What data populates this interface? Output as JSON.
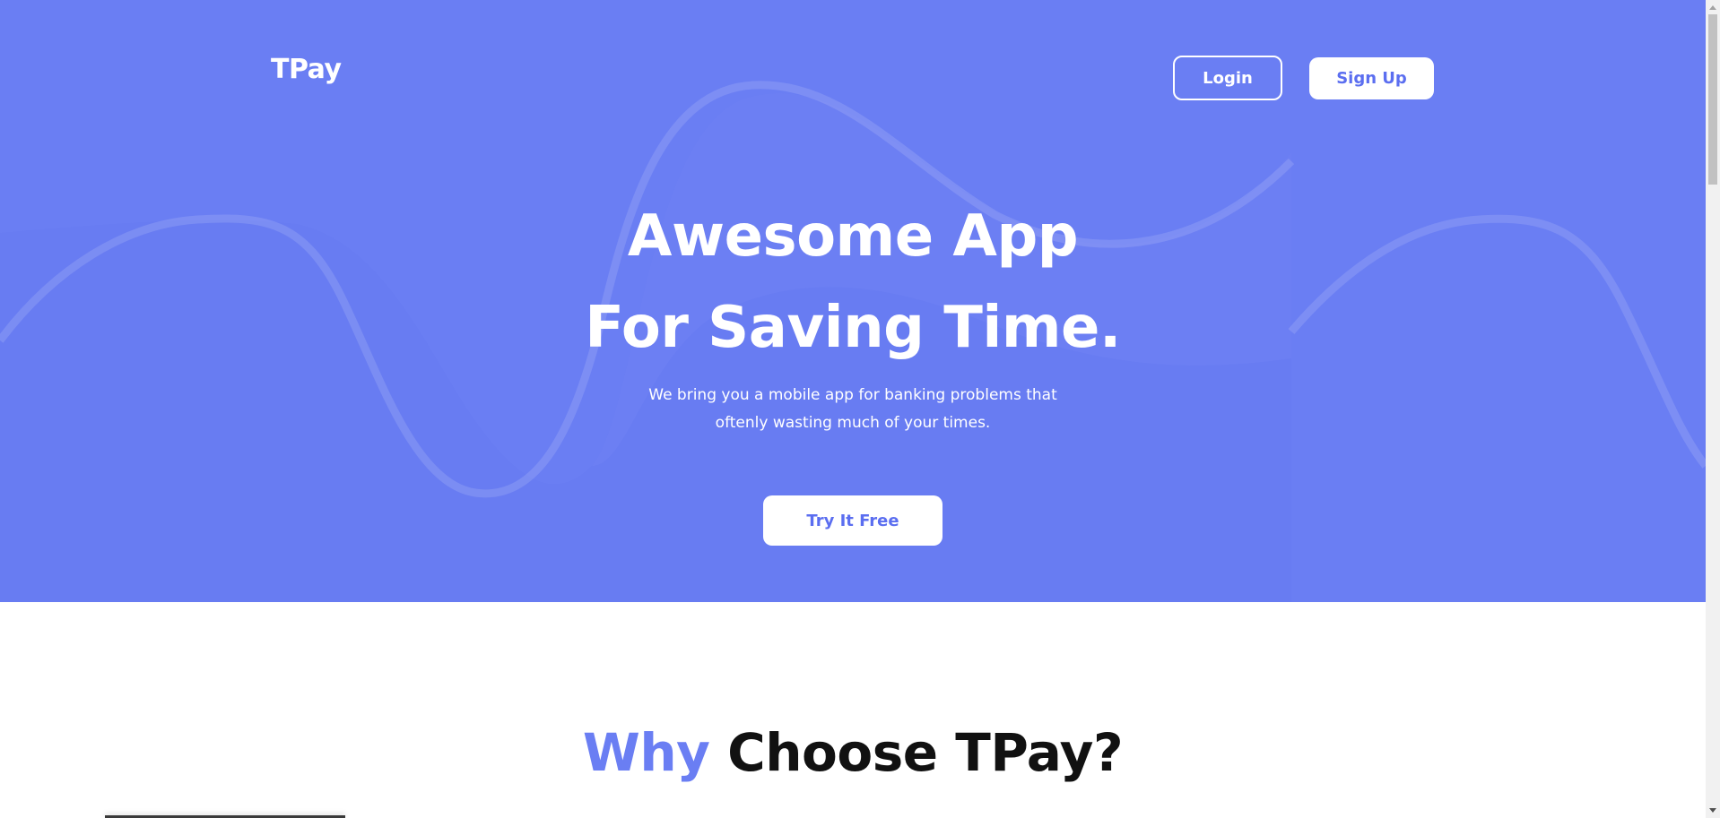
{
  "brand": {
    "name": "TPay"
  },
  "nav": {
    "login_label": "Login",
    "signup_label": "Sign Up"
  },
  "hero": {
    "title_line1": "Awesome App",
    "title_line2": "For Saving Time.",
    "subtitle_line1": "We bring you a mobile app for banking problems that",
    "subtitle_line2": "oftenly wasting much of your times.",
    "cta_label": "Try It Free"
  },
  "why": {
    "title_accent": "Why",
    "title_rest": " Choose TPay?"
  },
  "colors": {
    "primary": "#6a7ef3",
    "white": "#ffffff",
    "heading_dark": "#111111"
  },
  "icons": {
    "scroll_up": "chevron-up-icon",
    "scroll_down": "chevron-down-icon"
  }
}
